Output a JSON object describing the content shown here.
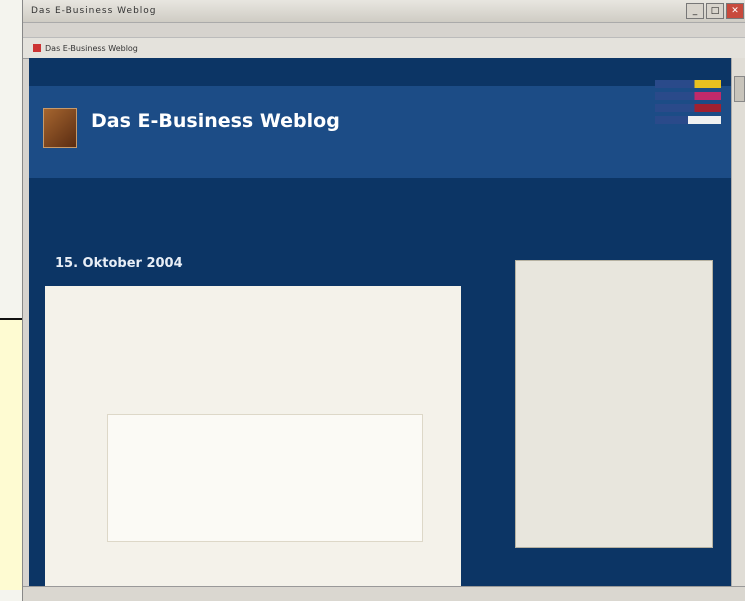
{
  "window": {
    "title": "Das E-Business Weblog",
    "min": "_",
    "max": "□",
    "close": "✕"
  },
  "menu": [
    "",
    "",
    ""
  ],
  "tab": {
    "label": "Das E-Business Weblog"
  },
  "site": {
    "title": "Das E-Business Weblog",
    "subtitle": "",
    "languages": [
      "",
      "",
      "",
      ""
    ],
    "intro_lines": [
      "",
      "",
      ""
    ]
  },
  "post": {
    "date": "15. Oktober 2004",
    "permalink": "",
    "title": "",
    "meta": "",
    "lead": "",
    "quote": "",
    "footer": ""
  },
  "sidebar": {
    "heading": "",
    "block1": "",
    "block2": "",
    "link": "",
    "big": "",
    "foot": ""
  },
  "status": {
    "text": ""
  },
  "colors": {
    "page_bg": "#0c3565",
    "header_bg": "#1c4c86",
    "post_bg": "#f4f2ea",
    "sidebar_bg": "#e8e6dd"
  }
}
